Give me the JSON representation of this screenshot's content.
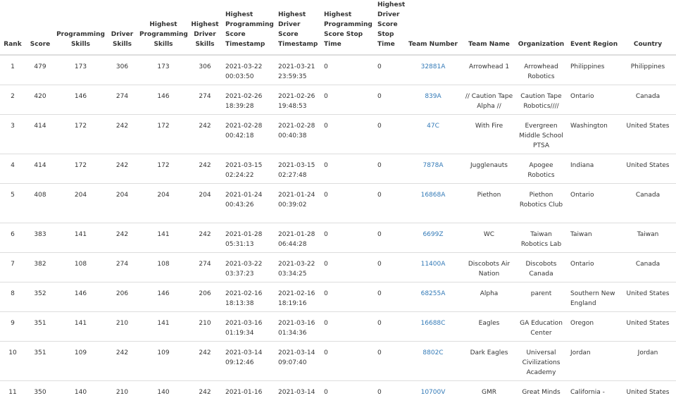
{
  "headers": {
    "rank": "Rank",
    "score": "Score",
    "programming_skills": "Programming Skills",
    "driver_skills": "Driver Skills",
    "highest_programming_skills": "Highest Programming Skills",
    "highest_driver_skills": "Highest Driver Skills",
    "highest_programming_timestamp": "Highest Programming Score Timestamp",
    "highest_driver_timestamp": "Highest Driver Score Timestamp",
    "highest_programming_stop_time": "Highest Programming Score Stop Time",
    "highest_driver_stop_time": "Highest Driver Score Stop Time",
    "team_number": "Team Number",
    "team_name": "Team Name",
    "organization": "Organization",
    "event_region": "Event Region",
    "country": "Country"
  },
  "rows": [
    {
      "rank": "1",
      "score": "479",
      "prog": "173",
      "driver": "306",
      "hprog": "173",
      "hdriver": "306",
      "prog_ts_date": "2021-03-22",
      "prog_ts_time": "00:03:50",
      "driver_ts_date": "2021-03-21",
      "driver_ts_time": "23:59:35",
      "prog_stop": "0",
      "driver_stop": "0",
      "team_number": "32881A",
      "team_name": "Arrowhead 1",
      "organization": "Arrowhead Robotics",
      "region": "Philippines",
      "country": "Philippines"
    },
    {
      "rank": "2",
      "score": "420",
      "prog": "146",
      "driver": "274",
      "hprog": "146",
      "hdriver": "274",
      "prog_ts_date": "2021-02-26",
      "prog_ts_time": "18:39:28",
      "driver_ts_date": "2021-02-26",
      "driver_ts_time": "19:48:53",
      "prog_stop": "0",
      "driver_stop": "0",
      "team_number": "839A",
      "team_name": "// Caution Tape Alpha //",
      "organization": "Caution Tape Robotics////",
      "region": "Ontario",
      "country": "Canada"
    },
    {
      "rank": "3",
      "score": "414",
      "prog": "172",
      "driver": "242",
      "hprog": "172",
      "hdriver": "242",
      "prog_ts_date": "2021-02-28",
      "prog_ts_time": "00:42:18",
      "driver_ts_date": "2021-02-28",
      "driver_ts_time": "00:40:38",
      "prog_stop": "0",
      "driver_stop": "0",
      "team_number": "47C",
      "team_name": "With Fire",
      "organization": "Evergreen Middle School PTSA",
      "region": "Washington",
      "country": "United States"
    },
    {
      "rank": "4",
      "score": "414",
      "prog": "172",
      "driver": "242",
      "hprog": "172",
      "hdriver": "242",
      "prog_ts_date": "2021-03-15",
      "prog_ts_time": "02:24:22",
      "driver_ts_date": "2021-03-15",
      "driver_ts_time": "02:27:48",
      "prog_stop": "0",
      "driver_stop": "0",
      "team_number": "7878A",
      "team_name": "Jugglenauts",
      "organization": "Apogee Robotics",
      "region": "Indiana",
      "country": "United States"
    },
    {
      "rank": "5",
      "score": "408",
      "prog": "204",
      "driver": "204",
      "hprog": "204",
      "hdriver": "204",
      "prog_ts_date": "2021-01-24",
      "prog_ts_time": "00:43:26",
      "driver_ts_date": "2021-01-24",
      "driver_ts_time": "00:39:02",
      "prog_stop": "0",
      "driver_stop": "0",
      "team_number": "16868A",
      "team_name": "Piethon",
      "organization": "Piethon Robotics Club",
      "region": "Ontario",
      "country": "Canada"
    },
    {
      "rank": "6",
      "score": "383",
      "prog": "141",
      "driver": "242",
      "hprog": "141",
      "hdriver": "242",
      "prog_ts_date": "2021-01-28",
      "prog_ts_time": "05:31:13",
      "driver_ts_date": "2021-01-28",
      "driver_ts_time": "06:44:28",
      "prog_stop": "0",
      "driver_stop": "0",
      "team_number": "6699Z",
      "team_name": "WC",
      "organization": "Taiwan Robotics Lab",
      "region": "Taiwan",
      "country": "Taiwan"
    },
    {
      "rank": "7",
      "score": "382",
      "prog": "108",
      "driver": "274",
      "hprog": "108",
      "hdriver": "274",
      "prog_ts_date": "2021-03-22",
      "prog_ts_time": "03:37:23",
      "driver_ts_date": "2021-03-22",
      "driver_ts_time": "03:34:25",
      "prog_stop": "0",
      "driver_stop": "0",
      "team_number": "11400A",
      "team_name": "Discobots Air Nation",
      "organization": "Discobots Canada",
      "region": "Ontario",
      "country": "Canada"
    },
    {
      "rank": "8",
      "score": "352",
      "prog": "146",
      "driver": "206",
      "hprog": "146",
      "hdriver": "206",
      "prog_ts_date": "2021-02-16",
      "prog_ts_time": "18:13:38",
      "driver_ts_date": "2021-02-16",
      "driver_ts_time": "18:19:16",
      "prog_stop": "0",
      "driver_stop": "0",
      "team_number": "68255A",
      "team_name": "Alpha",
      "organization": "parent",
      "region": "Southern New England",
      "country": "United States"
    },
    {
      "rank": "9",
      "score": "351",
      "prog": "141",
      "driver": "210",
      "hprog": "141",
      "hdriver": "210",
      "prog_ts_date": "2021-03-16",
      "prog_ts_time": "01:19:34",
      "driver_ts_date": "2021-03-16",
      "driver_ts_time": "01:34:36",
      "prog_stop": "0",
      "driver_stop": "0",
      "team_number": "16688C",
      "team_name": "Eagles",
      "organization": "GA Education Center",
      "region": "Oregon",
      "country": "United States"
    },
    {
      "rank": "10",
      "score": "351",
      "prog": "109",
      "driver": "242",
      "hprog": "109",
      "hdriver": "242",
      "prog_ts_date": "2021-03-14",
      "prog_ts_time": "09:12:46",
      "driver_ts_date": "2021-03-14",
      "driver_ts_time": "09:07:40",
      "prog_stop": "0",
      "driver_stop": "0",
      "team_number": "8802C",
      "team_name": "Dark Eagles",
      "organization": "Universal Civilizations Academy",
      "region": "Jordan",
      "country": "Jordan"
    },
    {
      "rank": "11",
      "score": "350",
      "prog": "140",
      "driver": "210",
      "hprog": "140",
      "hdriver": "242",
      "prog_ts_date": "2021-01-16",
      "prog_ts_time": "",
      "driver_ts_date": "2021-03-14",
      "driver_ts_time": "",
      "prog_stop": "0",
      "driver_stop": "0",
      "team_number": "10700V",
      "team_name": "GMR",
      "organization": "Great Minds",
      "region": "California -",
      "country": "United States"
    }
  ]
}
